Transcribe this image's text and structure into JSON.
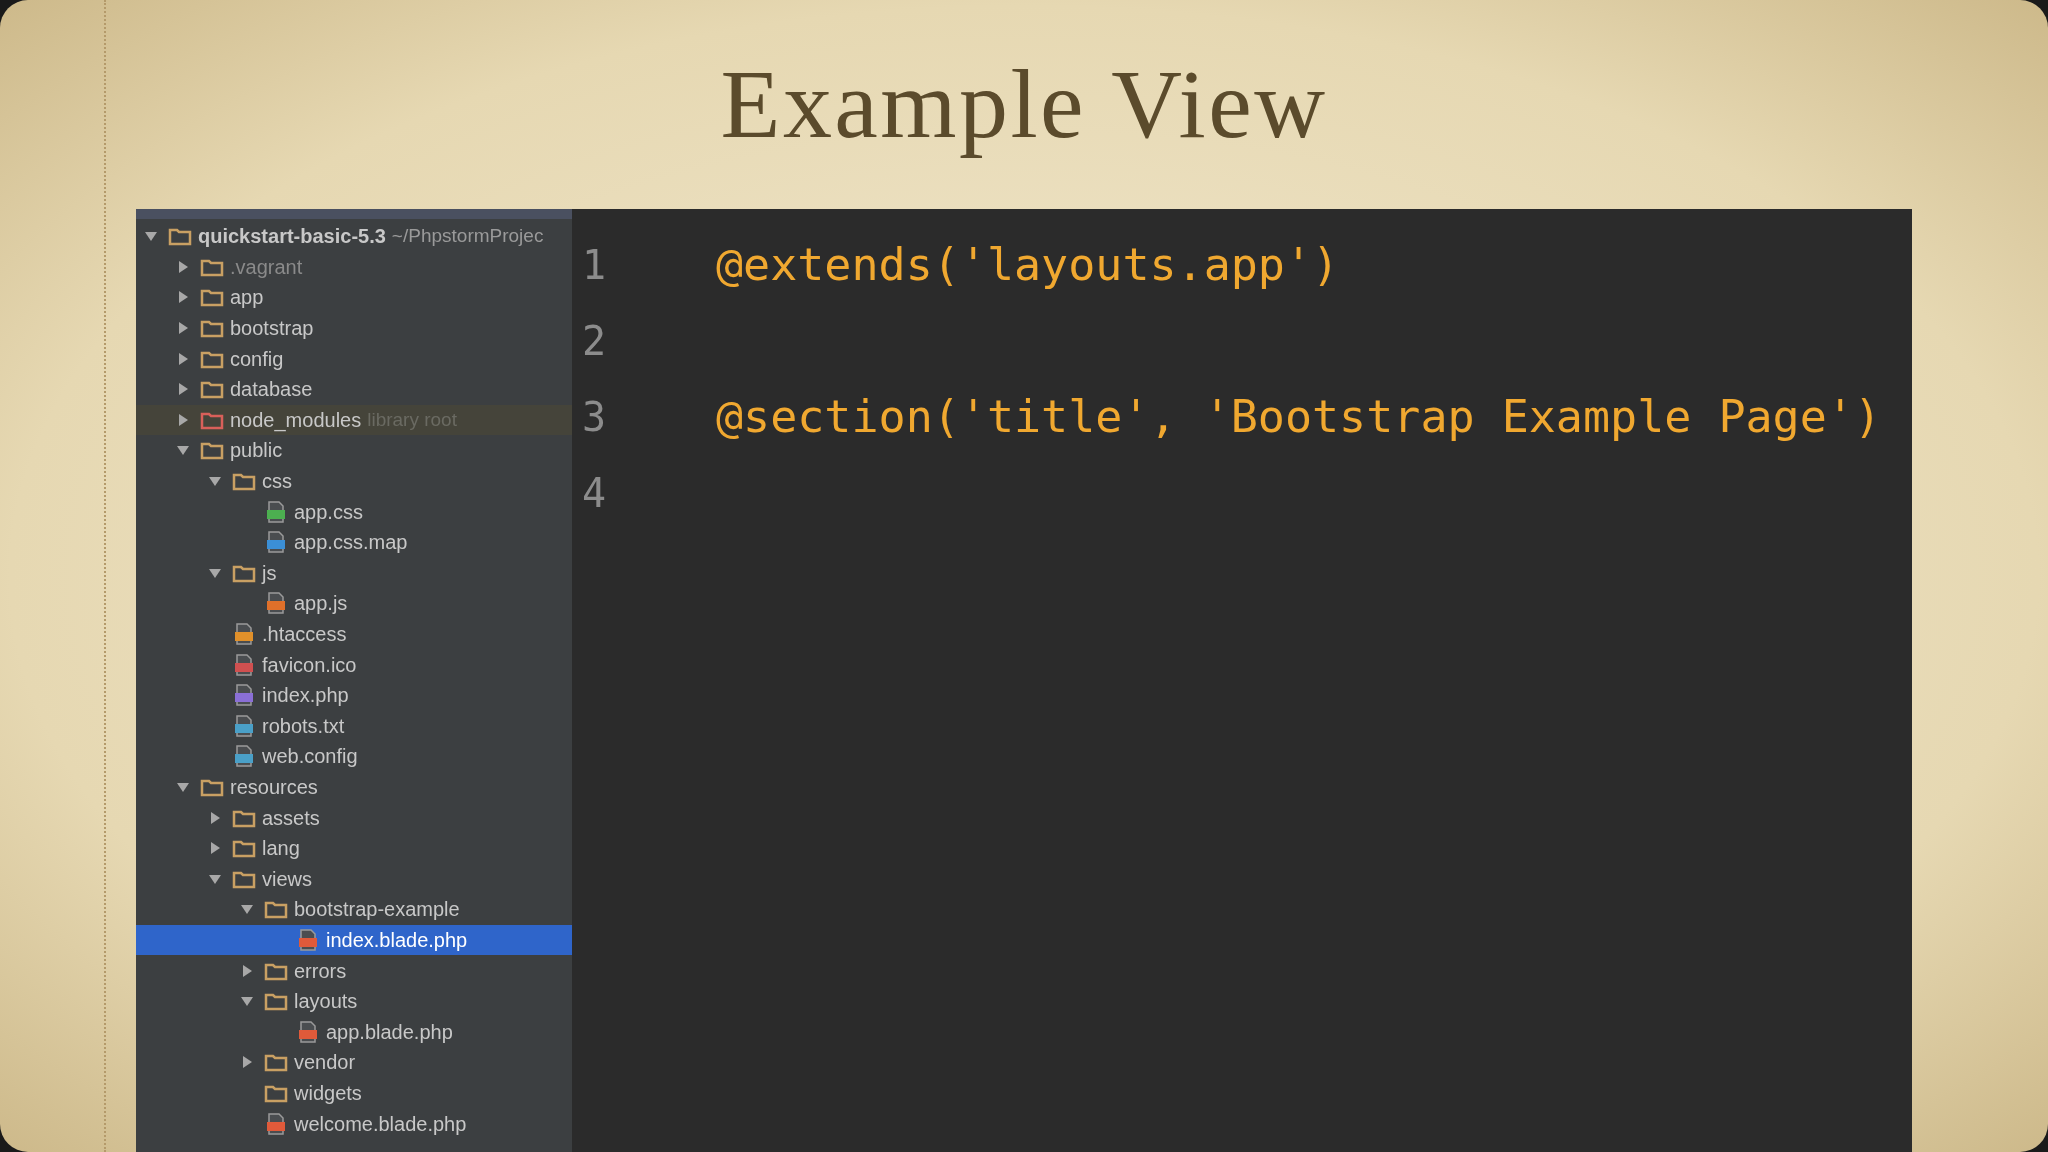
{
  "slide": {
    "title": "Example View"
  },
  "project_tree": {
    "root": {
      "label": "quickstart-basic-5.3",
      "hint": "~/PhpstormProjec",
      "kind": "folder",
      "expanded": true,
      "selected": false,
      "children": [
        {
          "label": ".vagrant",
          "kind": "folder",
          "expanded": false,
          "selected": false,
          "dimmed": true
        },
        {
          "label": "app",
          "kind": "folder",
          "expanded": false,
          "selected": false
        },
        {
          "label": "bootstrap",
          "kind": "folder",
          "expanded": false,
          "selected": false
        },
        {
          "label": "config",
          "kind": "folder",
          "expanded": false,
          "selected": false
        },
        {
          "label": "database",
          "kind": "folder",
          "expanded": false,
          "selected": false
        },
        {
          "label": "node_modules",
          "hint": "library root",
          "kind": "library",
          "expanded": false,
          "selected": false
        },
        {
          "label": "public",
          "kind": "folder",
          "expanded": true,
          "selected": false,
          "children": [
            {
              "label": "css",
              "kind": "folder",
              "expanded": true,
              "selected": false,
              "children": [
                {
                  "label": "app.css",
                  "kind": "css",
                  "selected": false
                },
                {
                  "label": "app.css.map",
                  "kind": "json",
                  "selected": false
                }
              ]
            },
            {
              "label": "js",
              "kind": "folder",
              "expanded": true,
              "selected": false,
              "children": [
                {
                  "label": "app.js",
                  "kind": "js",
                  "selected": false
                }
              ]
            },
            {
              "label": ".htaccess",
              "kind": "config",
              "selected": false
            },
            {
              "label": "favicon.ico",
              "kind": "image",
              "selected": false
            },
            {
              "label": "index.php",
              "kind": "php",
              "selected": false
            },
            {
              "label": "robots.txt",
              "kind": "text",
              "selected": false
            },
            {
              "label": "web.config",
              "kind": "text",
              "selected": false
            }
          ]
        },
        {
          "label": "resources",
          "kind": "folder",
          "expanded": true,
          "selected": false,
          "children": [
            {
              "label": "assets",
              "kind": "folder",
              "expanded": false,
              "selected": false
            },
            {
              "label": "lang",
              "kind": "folder",
              "expanded": false,
              "selected": false
            },
            {
              "label": "views",
              "kind": "folder",
              "expanded": true,
              "selected": false,
              "children": [
                {
                  "label": "bootstrap-example",
                  "kind": "folder",
                  "expanded": true,
                  "selected": false,
                  "children": [
                    {
                      "label": "index.blade.php",
                      "kind": "blade",
                      "selected": true
                    }
                  ]
                },
                {
                  "label": "errors",
                  "kind": "folder",
                  "expanded": false,
                  "selected": false
                },
                {
                  "label": "layouts",
                  "kind": "folder",
                  "expanded": true,
                  "selected": false,
                  "children": [
                    {
                      "label": "app.blade.php",
                      "kind": "blade",
                      "selected": false
                    }
                  ]
                },
                {
                  "label": "vendor",
                  "kind": "folder",
                  "expanded": false,
                  "selected": false
                },
                {
                  "label": "widgets",
                  "kind": "folder",
                  "selected": false
                },
                {
                  "label": "welcome.blade.php",
                  "kind": "blade",
                  "selected": false
                }
              ]
            }
          ]
        }
      ]
    }
  },
  "editor": {
    "lines": [
      {
        "number": "1",
        "code": "@extends('layouts.app')"
      },
      {
        "number": "2"
      },
      {
        "number": "3",
        "code": "@section('title', 'Bootstrap Example Page')"
      },
      {
        "number": "4"
      }
    ]
  }
}
